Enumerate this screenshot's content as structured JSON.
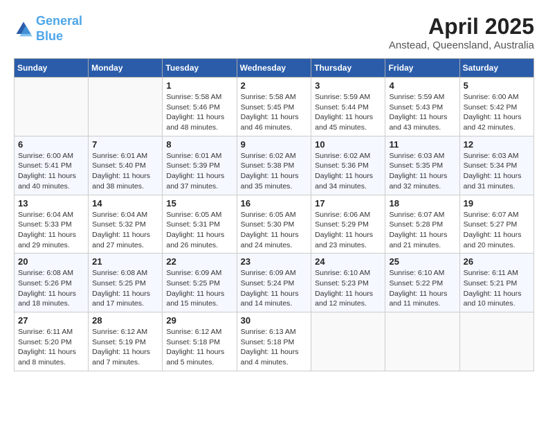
{
  "header": {
    "logo_line1": "General",
    "logo_line2": "Blue",
    "title": "April 2025",
    "subtitle": "Anstead, Queensland, Australia"
  },
  "calendar": {
    "days_of_week": [
      "Sunday",
      "Monday",
      "Tuesday",
      "Wednesday",
      "Thursday",
      "Friday",
      "Saturday"
    ],
    "weeks": [
      [
        {
          "day": "",
          "info": ""
        },
        {
          "day": "",
          "info": ""
        },
        {
          "day": "1",
          "info": "Sunrise: 5:58 AM\nSunset: 5:46 PM\nDaylight: 11 hours and 48 minutes."
        },
        {
          "day": "2",
          "info": "Sunrise: 5:58 AM\nSunset: 5:45 PM\nDaylight: 11 hours and 46 minutes."
        },
        {
          "day": "3",
          "info": "Sunrise: 5:59 AM\nSunset: 5:44 PM\nDaylight: 11 hours and 45 minutes."
        },
        {
          "day": "4",
          "info": "Sunrise: 5:59 AM\nSunset: 5:43 PM\nDaylight: 11 hours and 43 minutes."
        },
        {
          "day": "5",
          "info": "Sunrise: 6:00 AM\nSunset: 5:42 PM\nDaylight: 11 hours and 42 minutes."
        }
      ],
      [
        {
          "day": "6",
          "info": "Sunrise: 6:00 AM\nSunset: 5:41 PM\nDaylight: 11 hours and 40 minutes."
        },
        {
          "day": "7",
          "info": "Sunrise: 6:01 AM\nSunset: 5:40 PM\nDaylight: 11 hours and 38 minutes."
        },
        {
          "day": "8",
          "info": "Sunrise: 6:01 AM\nSunset: 5:39 PM\nDaylight: 11 hours and 37 minutes."
        },
        {
          "day": "9",
          "info": "Sunrise: 6:02 AM\nSunset: 5:38 PM\nDaylight: 11 hours and 35 minutes."
        },
        {
          "day": "10",
          "info": "Sunrise: 6:02 AM\nSunset: 5:36 PM\nDaylight: 11 hours and 34 minutes."
        },
        {
          "day": "11",
          "info": "Sunrise: 6:03 AM\nSunset: 5:35 PM\nDaylight: 11 hours and 32 minutes."
        },
        {
          "day": "12",
          "info": "Sunrise: 6:03 AM\nSunset: 5:34 PM\nDaylight: 11 hours and 31 minutes."
        }
      ],
      [
        {
          "day": "13",
          "info": "Sunrise: 6:04 AM\nSunset: 5:33 PM\nDaylight: 11 hours and 29 minutes."
        },
        {
          "day": "14",
          "info": "Sunrise: 6:04 AM\nSunset: 5:32 PM\nDaylight: 11 hours and 27 minutes."
        },
        {
          "day": "15",
          "info": "Sunrise: 6:05 AM\nSunset: 5:31 PM\nDaylight: 11 hours and 26 minutes."
        },
        {
          "day": "16",
          "info": "Sunrise: 6:05 AM\nSunset: 5:30 PM\nDaylight: 11 hours and 24 minutes."
        },
        {
          "day": "17",
          "info": "Sunrise: 6:06 AM\nSunset: 5:29 PM\nDaylight: 11 hours and 23 minutes."
        },
        {
          "day": "18",
          "info": "Sunrise: 6:07 AM\nSunset: 5:28 PM\nDaylight: 11 hours and 21 minutes."
        },
        {
          "day": "19",
          "info": "Sunrise: 6:07 AM\nSunset: 5:27 PM\nDaylight: 11 hours and 20 minutes."
        }
      ],
      [
        {
          "day": "20",
          "info": "Sunrise: 6:08 AM\nSunset: 5:26 PM\nDaylight: 11 hours and 18 minutes."
        },
        {
          "day": "21",
          "info": "Sunrise: 6:08 AM\nSunset: 5:25 PM\nDaylight: 11 hours and 17 minutes."
        },
        {
          "day": "22",
          "info": "Sunrise: 6:09 AM\nSunset: 5:25 PM\nDaylight: 11 hours and 15 minutes."
        },
        {
          "day": "23",
          "info": "Sunrise: 6:09 AM\nSunset: 5:24 PM\nDaylight: 11 hours and 14 minutes."
        },
        {
          "day": "24",
          "info": "Sunrise: 6:10 AM\nSunset: 5:23 PM\nDaylight: 11 hours and 12 minutes."
        },
        {
          "day": "25",
          "info": "Sunrise: 6:10 AM\nSunset: 5:22 PM\nDaylight: 11 hours and 11 minutes."
        },
        {
          "day": "26",
          "info": "Sunrise: 6:11 AM\nSunset: 5:21 PM\nDaylight: 11 hours and 10 minutes."
        }
      ],
      [
        {
          "day": "27",
          "info": "Sunrise: 6:11 AM\nSunset: 5:20 PM\nDaylight: 11 hours and 8 minutes."
        },
        {
          "day": "28",
          "info": "Sunrise: 6:12 AM\nSunset: 5:19 PM\nDaylight: 11 hours and 7 minutes."
        },
        {
          "day": "29",
          "info": "Sunrise: 6:12 AM\nSunset: 5:18 PM\nDaylight: 11 hours and 5 minutes."
        },
        {
          "day": "30",
          "info": "Sunrise: 6:13 AM\nSunset: 5:18 PM\nDaylight: 11 hours and 4 minutes."
        },
        {
          "day": "",
          "info": ""
        },
        {
          "day": "",
          "info": ""
        },
        {
          "day": "",
          "info": ""
        }
      ]
    ]
  }
}
